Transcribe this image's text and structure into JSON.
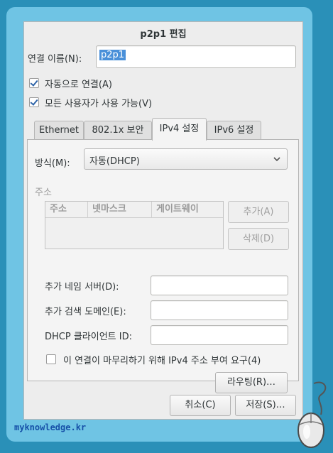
{
  "colors": {
    "outer_background": "#2a90b8",
    "frame": "#6fc4e4",
    "dialog_background": "#ededed",
    "selection": "#4a90d9",
    "watermark_text": "#1650a8"
  },
  "dialog": {
    "title": "p2p1 편집",
    "connection_name_label": "연결 이름(N):",
    "connection_name_value": "p2p1",
    "auto_connect_label": "자동으로 연결(A)",
    "auto_connect_checked": true,
    "all_users_label": "모든 사용자가 사용 가능(V)",
    "all_users_checked": true
  },
  "tabs": [
    {
      "label": "Ethernet",
      "active": false
    },
    {
      "label": "802.1x 보안",
      "active": false
    },
    {
      "label": "IPv4 설정",
      "active": true
    },
    {
      "label": "IPv6 설정",
      "active": false
    }
  ],
  "ipv4": {
    "method_label": "방식(M):",
    "method_value": "자동(DHCP)",
    "method_icon": "chevron-down-icon",
    "address_section_label": "주소",
    "address_columns": [
      "주소",
      "넷마스크",
      "게이트웨이"
    ],
    "add_button": "추가(A)",
    "delete_button": "삭제(D)",
    "extra_dns_label": "추가 네임 서버(D):",
    "extra_dns_value": "",
    "extra_search_label": "추가 검색 도메인(E):",
    "extra_search_value": "",
    "dhcp_client_id_label": "DHCP 클라이언트 ID:",
    "dhcp_client_id_value": "",
    "require_ipv4_label": "이 연결이 마무리하기 위해 IPv4 주소 부여 요구(4)",
    "require_ipv4_checked": false,
    "routes_button": "라우팅(R)…"
  },
  "buttons": {
    "cancel": "취소(C)",
    "save": "저장(S)…"
  },
  "watermark": "myknowledge.kr"
}
